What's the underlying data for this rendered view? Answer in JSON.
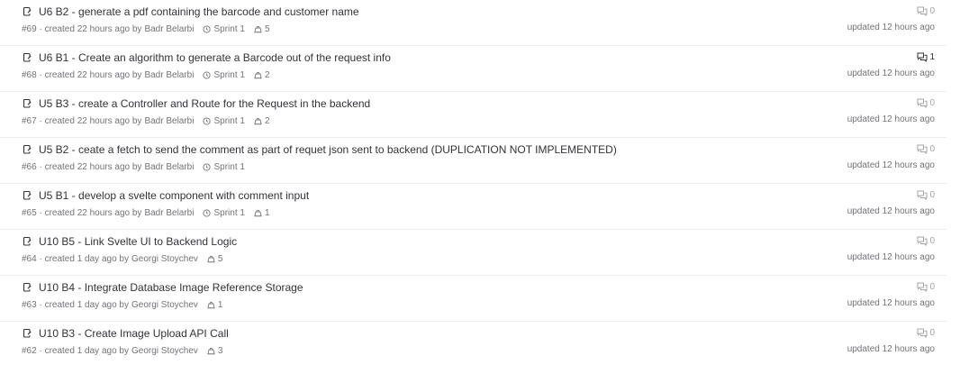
{
  "issues": [
    {
      "title": "U6 B2 - generate a pdf containing the barcode and customer name",
      "id": "#69",
      "created": "created 22 hours ago by",
      "author": "Badr Belarbi",
      "milestone": "Sprint 1",
      "weight": "5",
      "comments": "0",
      "updated": "updated 12 hours ago"
    },
    {
      "title": "U6 B1 - Create an algorithm to generate a Barcode out of the request info",
      "id": "#68",
      "created": "created 22 hours ago by",
      "author": "Badr Belarbi",
      "milestone": "Sprint 1",
      "weight": "2",
      "comments": "1",
      "updated": "updated 12 hours ago"
    },
    {
      "title": "U5 B3 - create a Controller and Route for the Request in the backend",
      "id": "#67",
      "created": "created 22 hours ago by",
      "author": "Badr Belarbi",
      "milestone": "Sprint 1",
      "weight": "2",
      "comments": "0",
      "updated": "updated 12 hours ago"
    },
    {
      "title": "U5 B2 - ceate a fetch to send the comment as part of requet json sent to backend (DUPLICATION NOT IMPLEMENTED)",
      "id": "#66",
      "created": "created 22 hours ago by",
      "author": "Badr Belarbi",
      "milestone": "Sprint 1",
      "weight": null,
      "comments": "0",
      "updated": "updated 12 hours ago"
    },
    {
      "title": "U5 B1 - develop a svelte component with comment input",
      "id": "#65",
      "created": "created 22 hours ago by",
      "author": "Badr Belarbi",
      "milestone": "Sprint 1",
      "weight": "1",
      "comments": "0",
      "updated": "updated 12 hours ago"
    },
    {
      "title": "U10 B5 - Link Svelte UI to Backend Logic",
      "id": "#64",
      "created": "created 1 day ago by",
      "author": "Georgi Stoychev",
      "milestone": null,
      "weight": "5",
      "comments": "0",
      "updated": "updated 12 hours ago"
    },
    {
      "title": "U10 B4 - Integrate Database Image Reference Storage",
      "id": "#63",
      "created": "created 1 day ago by",
      "author": "Georgi Stoychev",
      "milestone": null,
      "weight": "1",
      "comments": "0",
      "updated": "updated 12 hours ago"
    },
    {
      "title": "U10 B3 - Create Image Upload API Call",
      "id": "#62",
      "created": "created 1 day ago by",
      "author": "Georgi Stoychev",
      "milestone": null,
      "weight": "3",
      "comments": "0",
      "updated": "updated 12 hours ago"
    }
  ]
}
